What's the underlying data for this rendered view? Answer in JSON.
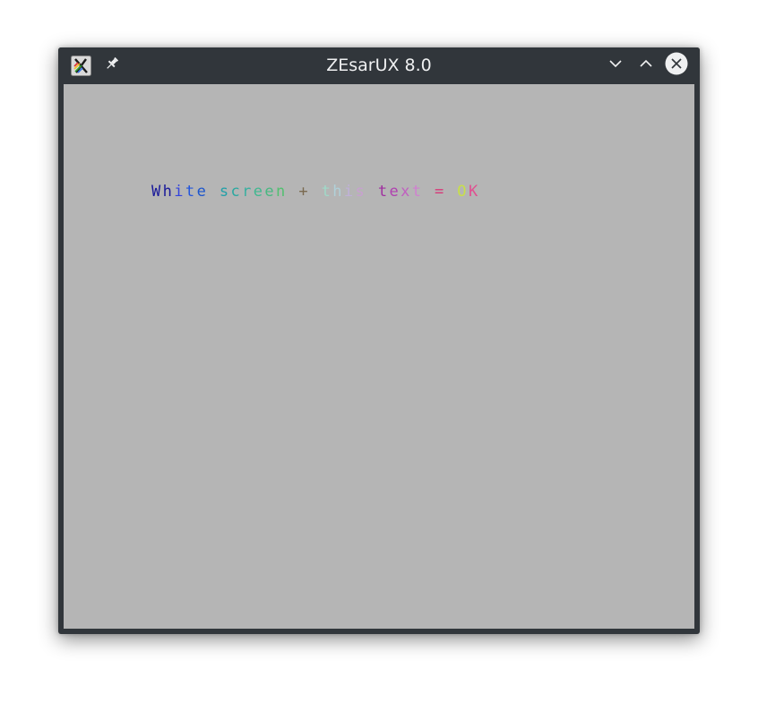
{
  "window": {
    "title": "ZEsarUX 8.0",
    "icons": {
      "app": "zesarux-logo-icon",
      "pin": "pin-icon",
      "minimize": "chevron-down-icon",
      "maximize": "chevron-up-icon",
      "close": "close-icon"
    }
  },
  "screen": {
    "message": "White screen + this text = OK",
    "letter_colors": [
      "#1a1a9a",
      "#1a1a9a",
      "#3344dd",
      "#2255dd",
      "#1c55cc",
      "#b5b5b5",
      "#22a0a8",
      "#2aa8a0",
      "#38b0a0",
      "#40b890",
      "#48b880",
      "#52c070",
      "#b5b5b5",
      "#7a6a50",
      "#b5b5b5",
      "#a0d8c8",
      "#b0d0d8",
      "#c0b0d8",
      "#c8a0d0",
      "#b5b5b5",
      "#a030a0",
      "#b040b0",
      "#c060c0",
      "#d080d0",
      "#b5b5b5",
      "#d83878",
      "#b5b5b5",
      "#c8e048",
      "#e05090"
    ]
  }
}
